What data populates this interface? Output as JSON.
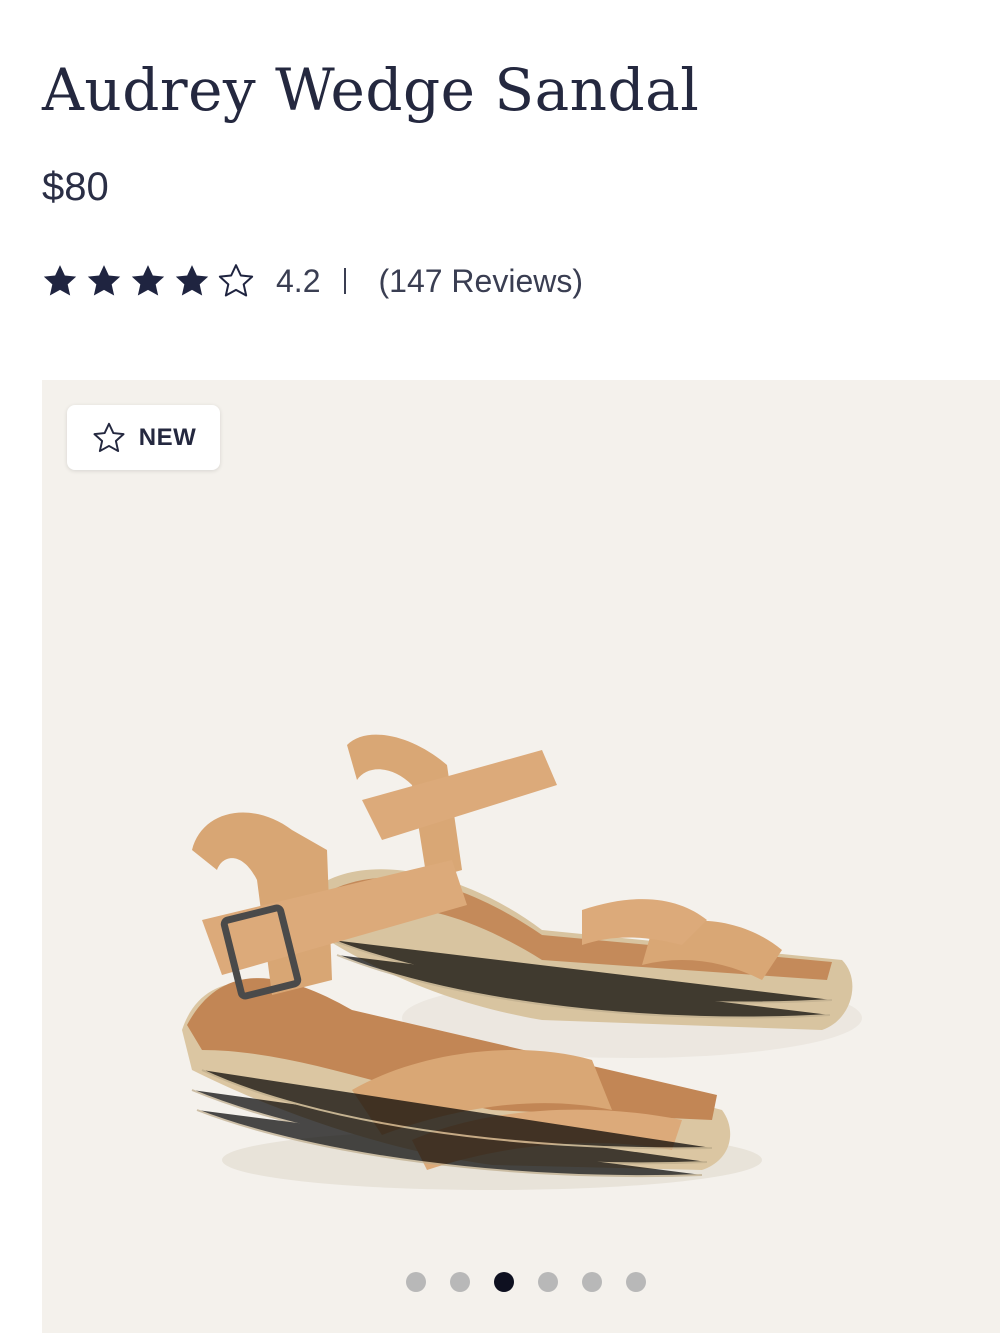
{
  "product": {
    "name": "Audrey Wedge Sandal",
    "price": "$80",
    "rating": {
      "value": "4.2",
      "stars_filled": 4,
      "stars_total": 5,
      "reviews_text": "(147 Reviews)"
    }
  },
  "gallery": {
    "badge_label": "NEW",
    "image_alt": "Audrey Wedge Sandal - pair of tan suede espadrille wedge sandals",
    "image_count": 6,
    "active_index": 2,
    "background_color": "#f4f1ec"
  },
  "colors": {
    "text": "#24283f",
    "star": "#1f2440",
    "dot_inactive": "#b8b8b8",
    "dot_active": "#0e1020"
  },
  "icons": {
    "star_filled": "star-filled-icon",
    "star_empty": "star-outline-icon",
    "badge": "star-outline-icon"
  }
}
